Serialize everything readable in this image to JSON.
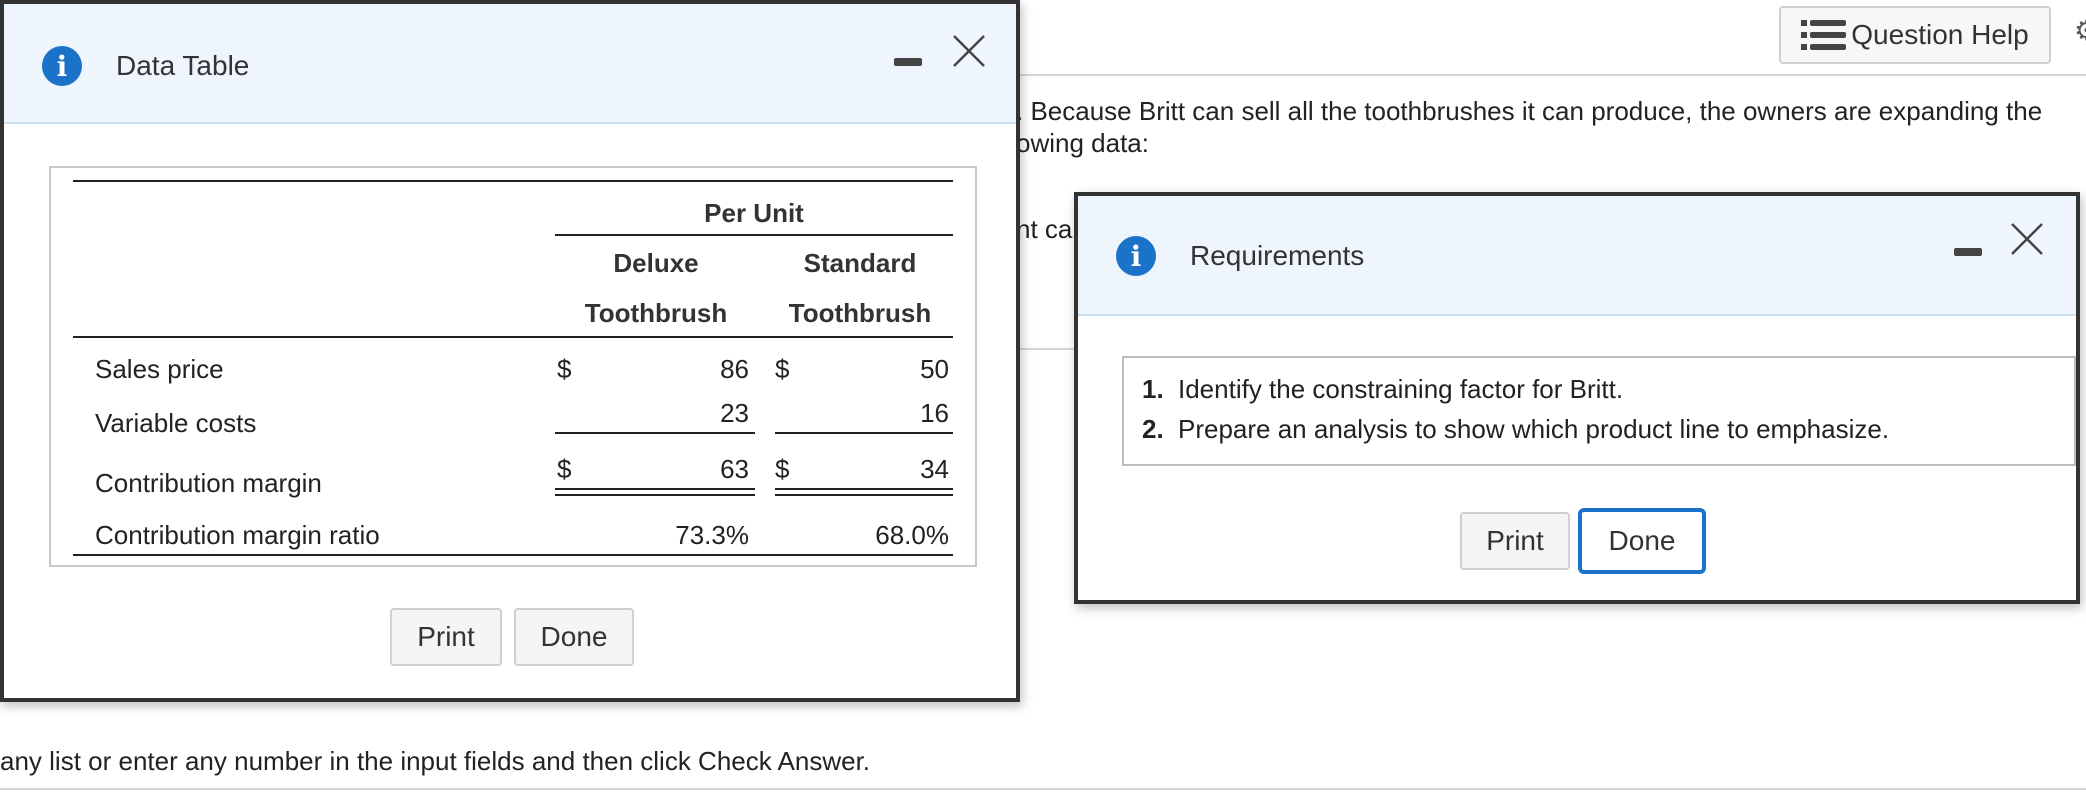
{
  "background": {
    "question_help_label": "Question Help",
    "text_line_1": ". Because Britt can sell all the toothbrushes it can produce, the owners are expanding the",
    "text_line_2": "owing data:",
    "text_fragment": "nt ca",
    "bottom_text": "any list or enter any number in the input fields and then click Check Answer."
  },
  "data_table_dialog": {
    "title": "Data Table",
    "header": {
      "group": "Per Unit",
      "col1_line1": "Deluxe",
      "col1_line2": "Toothbrush",
      "col2_line1": "Standard",
      "col2_line2": "Toothbrush"
    },
    "rows": [
      {
        "label": "Sales price",
        "cur1": "$",
        "val1": "86",
        "cur2": "$",
        "val2": "50"
      },
      {
        "label": "Variable costs",
        "cur1": "",
        "val1": "23",
        "cur2": "",
        "val2": "16"
      },
      {
        "label": "Contribution margin",
        "cur1": "$",
        "val1": "63",
        "cur2": "$",
        "val2": "34"
      },
      {
        "label": "Contribution margin ratio",
        "cur1": "",
        "val1": "73.3%",
        "cur2": "",
        "val2": "68.0%"
      }
    ],
    "print_label": "Print",
    "done_label": "Done"
  },
  "requirements_dialog": {
    "title": "Requirements",
    "items": [
      {
        "num": "1.",
        "text": "Identify the constraining factor for Britt."
      },
      {
        "num": "2.",
        "text": "Prepare an analysis to show which product line to emphasize."
      }
    ],
    "print_label": "Print",
    "done_label": "Done"
  }
}
